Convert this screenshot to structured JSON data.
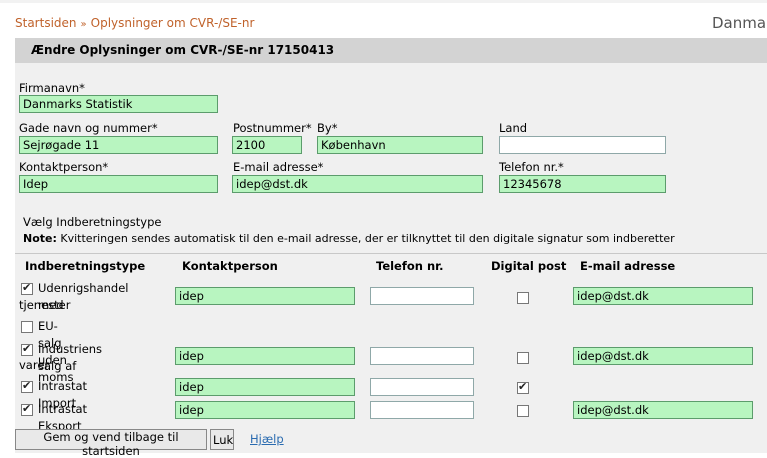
{
  "breadcrumb": {
    "items": [
      "Startsiden",
      "Oplysninger om CVR-/SE-nr"
    ],
    "separator": "»"
  },
  "country_text": "Danmar",
  "header": {
    "title": "Ændre Oplysninger om CVR-/SE-nr 17150413"
  },
  "form": {
    "firmanavn": {
      "label": "Firmanavn*",
      "value": "Danmarks Statistik"
    },
    "gade": {
      "label": "Gade navn og nummer*",
      "value": "Sejrøgade 11"
    },
    "postnummer": {
      "label": "Postnummer*",
      "value": "2100"
    },
    "by": {
      "label": "By*",
      "value": "København"
    },
    "land": {
      "label": "Land",
      "value": ""
    },
    "kontaktperson": {
      "label": "Kontaktperson*",
      "value": "Idep"
    },
    "email": {
      "label": "E-mail adresse*",
      "value": "idep@dst.dk"
    },
    "telefon": {
      "label": "Telefon nr.*",
      "value": "12345678"
    }
  },
  "type_section": {
    "title": "Vælg Indberetningstype",
    "note_label": "Note:",
    "note_text": "Kvitteringen sendes automatisk til den e-mail adresse, der er tilknyttet til den digitale signatur som indberetter"
  },
  "table": {
    "headers": [
      "Indberetningstype",
      "Kontaktperson",
      "Telefon nr.",
      "Digital post",
      "E-mail adresse"
    ],
    "rows": [
      {
        "line1": "Udenrigshandel med",
        "line2": "tjenester",
        "checked": true,
        "kontakt": "idep",
        "telefon": "",
        "digital_post": false,
        "email": "idep@dst.dk"
      },
      {
        "line1": "EU-salg uden moms",
        "line2": "",
        "checked": false
      },
      {
        "line1": "Industriens salg af",
        "line2": "varer",
        "checked": true,
        "kontakt": "idep",
        "telefon": "",
        "digital_post": false,
        "email": "idep@dst.dk"
      },
      {
        "line1": "Intrastat Import",
        "line2": "",
        "checked": true,
        "kontakt": "idep",
        "telefon": "",
        "digital_post": true
      },
      {
        "line1": "Intrastat Eksport",
        "line2": "",
        "checked": true,
        "kontakt": "idep",
        "telefon": "",
        "digital_post": false,
        "email": "idep@dst.dk"
      }
    ]
  },
  "buttons": {
    "save": "Gem og vend tilbage til startsiden",
    "close": "Luk",
    "help": "Hjælp"
  }
}
